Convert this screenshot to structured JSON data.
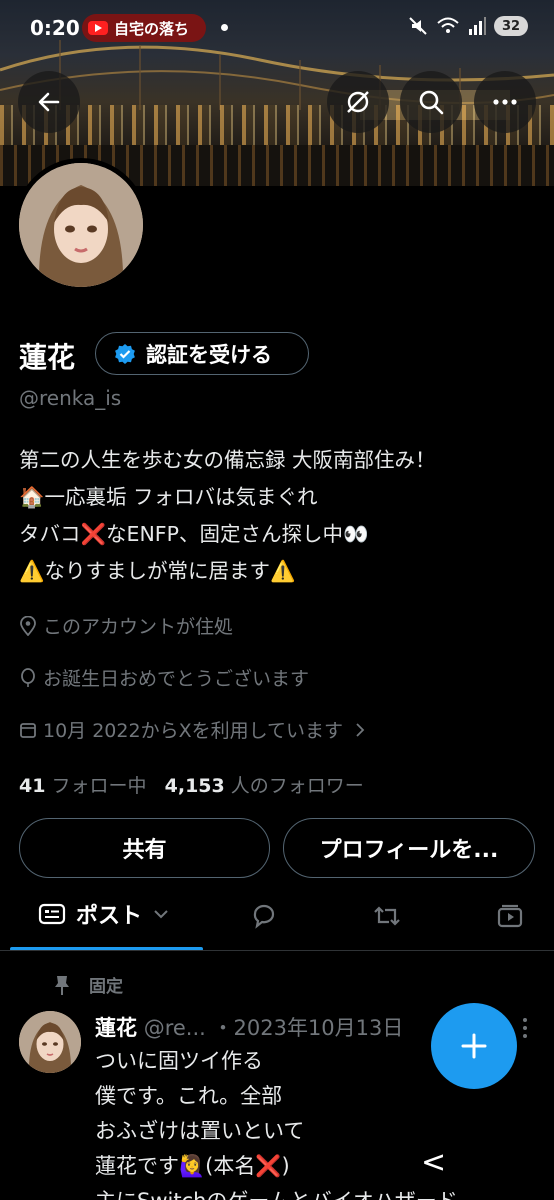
{
  "status_bar": {
    "time": "0:20",
    "notification_text": "自宅の落ち",
    "battery": "32"
  },
  "profile": {
    "name": "蓮花",
    "verify_label": "認証を受ける",
    "handle": "@renka_is",
    "bio_lines": [
      "第二の人生を歩む女の備忘録 大阪南部住み！",
      "🏠一応裏垢 フォロバは気まぐれ",
      "タバコ❌なENFP、固定さん探し中👀",
      "⚠️なりすましが常に居ます⚠️"
    ],
    "location": "このアカウントが住処",
    "birthday": "お誕生日おめでとうございます",
    "joined": "10月 2022からXを利用しています"
  },
  "stats": {
    "following_count": "41",
    "following_label": "フォロー中",
    "followers_count": "4,153",
    "followers_label": "人のフォロワー"
  },
  "buttons": {
    "share": "共有",
    "edit_profile": "プロフィールを..."
  },
  "tabs": {
    "posts": "ポスト"
  },
  "pinned_post": {
    "pinned_label": "固定",
    "author_name": "蓮花",
    "author_handle": "@re...",
    "date": "・2023年10月13日",
    "lines": [
      "ついに固ツイ作る",
      "僕です。これ。全部",
      "おふざけは置いといて",
      "蓮花です🙋‍♀️(本名❌)",
      "主にSwitchのゲームとバイオハザード"
    ]
  },
  "nav": {
    "back_gesture": "<"
  },
  "colors": {
    "accent": "#1d9bf0",
    "secondary_text": "#71767b",
    "border": "#536471",
    "background": "#000000"
  },
  "icons": [
    "back-arrow-icon",
    "hide-icon",
    "search-icon",
    "more-icon",
    "verified-icon",
    "location-icon",
    "balloon-icon",
    "calendar-icon",
    "chevron-right-icon",
    "posts-tab-icon",
    "chevron-down-icon",
    "reply-icon",
    "repost-icon",
    "media-icon",
    "pin-icon",
    "plus-icon"
  ]
}
